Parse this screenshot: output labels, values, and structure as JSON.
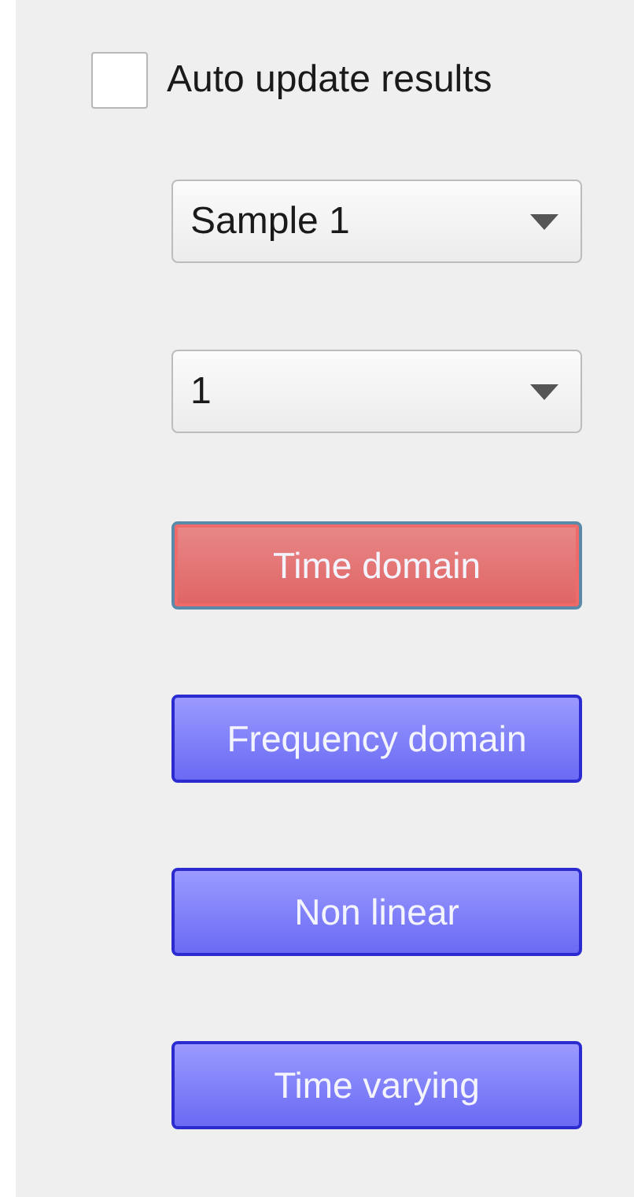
{
  "auto_update": {
    "label": "Auto update results",
    "checked": false
  },
  "dropdowns": [
    {
      "value": "Sample 1"
    },
    {
      "value": "1"
    }
  ],
  "buttons": [
    {
      "label": "Time domain",
      "selected": true
    },
    {
      "label": "Frequency domain",
      "selected": false
    },
    {
      "label": "Non linear",
      "selected": false
    },
    {
      "label": "Time varying",
      "selected": false
    }
  ]
}
